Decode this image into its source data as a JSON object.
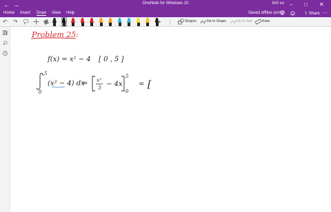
{
  "window": {
    "title": "OneNote for Windows 10",
    "user": "lich vu",
    "back_glyph": "←",
    "forward_glyph": "→",
    "minimize_glyph": "–",
    "maximize_glyph": "□",
    "close_glyph": "✕"
  },
  "menu": {
    "tabs": [
      "Home",
      "Insert",
      "Draw",
      "View",
      "Help"
    ],
    "active_tab": "Draw",
    "status": "Saved offline (error)",
    "share_label": "Share"
  },
  "ribbon": {
    "undo_glyph": "↶",
    "redo_glyph": "↷",
    "add_glyph": "+",
    "pens": [
      {
        "tip": "#222222",
        "selected": false
      },
      {
        "tip": "#111111",
        "selected": true
      },
      {
        "tip": "#e02020",
        "selected": false
      },
      {
        "tip": "#e02020",
        "selected": false
      },
      {
        "tip": "#e02020",
        "selected": false
      },
      {
        "tip": "#f0a020",
        "selected": false
      },
      {
        "tip": "#f0a020",
        "selected": false
      },
      {
        "tip": "#30b0e0",
        "selected": false
      },
      {
        "tip": "#30b0e0",
        "selected": false
      },
      {
        "tip": "#f0e020",
        "selected": false
      },
      {
        "tip": "#f0c020",
        "selected": false
      },
      {
        "tip": "#222222",
        "selected": false
      }
    ],
    "shapes_label": "Shapes",
    "ink_to_shape_label": "Ink to Shape",
    "ink_to_text_label": "Ink to Text",
    "ruler_label": "Ruler"
  },
  "accent": "#7b2c9e",
  "ink": {
    "problem_label": "Problem 25",
    "problem_colon": ":",
    "function": "f(x) = x² − 4",
    "interval": "[ 0 , 5 ]",
    "integral_upper": "5",
    "integral_lower": "0",
    "integrand": "(x² − 4) dx",
    "equals": "=",
    "antiderivative_num": "x³",
    "antiderivative_den": "3",
    "antiderivative_rest": "− 4x",
    "eval_upper": "5",
    "eval_lower": "0",
    "equals2": "=",
    "open_bracket": "["
  }
}
